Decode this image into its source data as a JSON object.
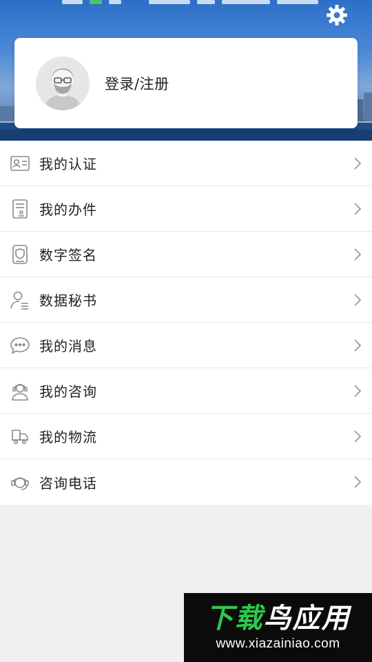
{
  "header": {
    "login_label": "登录/注册",
    "settings_icon": "gear-icon",
    "avatar_icon": "avatar-icon"
  },
  "menu": {
    "items": [
      {
        "label": "我的认证",
        "icon": "id-card-icon"
      },
      {
        "label": "我的办件",
        "icon": "document-icon"
      },
      {
        "label": "数字签名",
        "icon": "shield-badge-icon"
      },
      {
        "label": "数据秘书",
        "icon": "user-list-icon"
      },
      {
        "label": "我的消息",
        "icon": "chat-bubble-icon"
      },
      {
        "label": "我的咨询",
        "icon": "headset-user-icon"
      },
      {
        "label": "我的物流",
        "icon": "truck-icon"
      },
      {
        "label": "咨询电话",
        "icon": "phone-headset-icon"
      }
    ],
    "chevron_icon": "chevron-right-icon"
  },
  "watermark": {
    "brand_part1": "下载",
    "brand_part2": "鸟应用",
    "url": "www.xiazainiao.com"
  },
  "colors": {
    "header_blue": "#2d6fc7",
    "page_bg": "#f0f0f0",
    "card_bg": "#ffffff",
    "text_main": "#222222",
    "icon_gray": "#8a8a8a",
    "watermark_green": "#2cc94a"
  }
}
